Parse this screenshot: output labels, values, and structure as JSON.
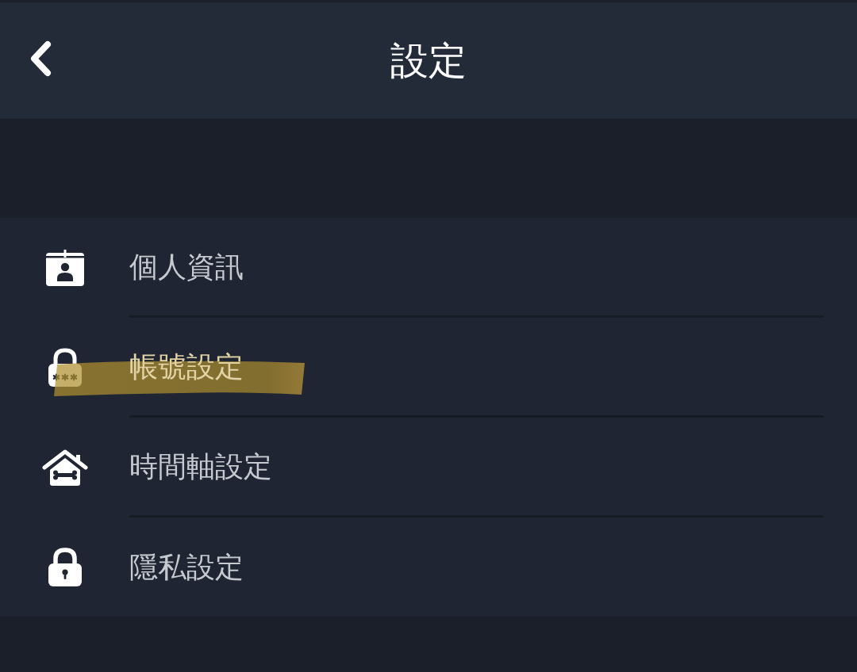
{
  "header": {
    "title": "設定"
  },
  "menu": {
    "items": [
      {
        "kind": "profile",
        "label": "個人資訊",
        "highlighted": false
      },
      {
        "kind": "account",
        "label": "帳號設定",
        "highlighted": true
      },
      {
        "kind": "timeline",
        "label": "時間軸設定",
        "highlighted": false
      },
      {
        "kind": "privacy",
        "label": "隱私設定",
        "highlighted": false
      }
    ]
  }
}
